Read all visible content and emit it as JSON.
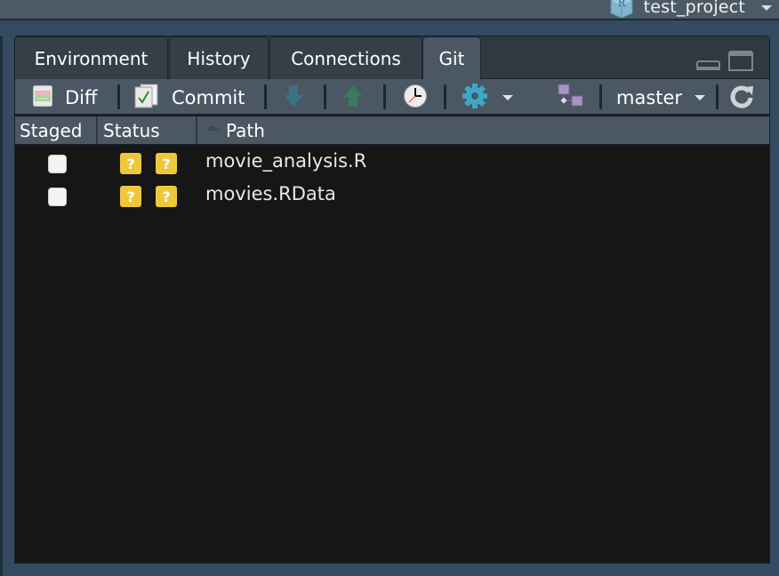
{
  "project": {
    "name": "test_project",
    "icon": "r-project-cube-icon"
  },
  "tabs": [
    {
      "label": "Environment",
      "active": false
    },
    {
      "label": "History",
      "active": false
    },
    {
      "label": "Connections",
      "active": false
    },
    {
      "label": "Git",
      "active": true
    }
  ],
  "window_controls": {
    "minimize": "minimize-icon",
    "maximize": "maximize-icon"
  },
  "toolbar": {
    "diff_label": "Diff",
    "commit_label": "Commit",
    "pull_icon": "pull-down-arrow-icon",
    "push_icon": "push-up-arrow-icon",
    "history_icon": "clock-icon",
    "settings_icon": "gear-icon",
    "branch_icon": "branch-diagram-icon",
    "branch_name": "master",
    "refresh_icon": "refresh-icon"
  },
  "columns": {
    "staged": "Staged",
    "status": "Status",
    "path": "Path"
  },
  "files": [
    {
      "staged": false,
      "status": [
        "?",
        "?"
      ],
      "path": "movie_analysis.R"
    },
    {
      "staged": false,
      "status": [
        "?",
        "?"
      ],
      "path": "movies.RData"
    }
  ],
  "colors": {
    "status_untracked": "#eec83c",
    "toolbar_bg": "#4b5762",
    "pane_bg": "#161616",
    "app_bg": "#344a61"
  }
}
